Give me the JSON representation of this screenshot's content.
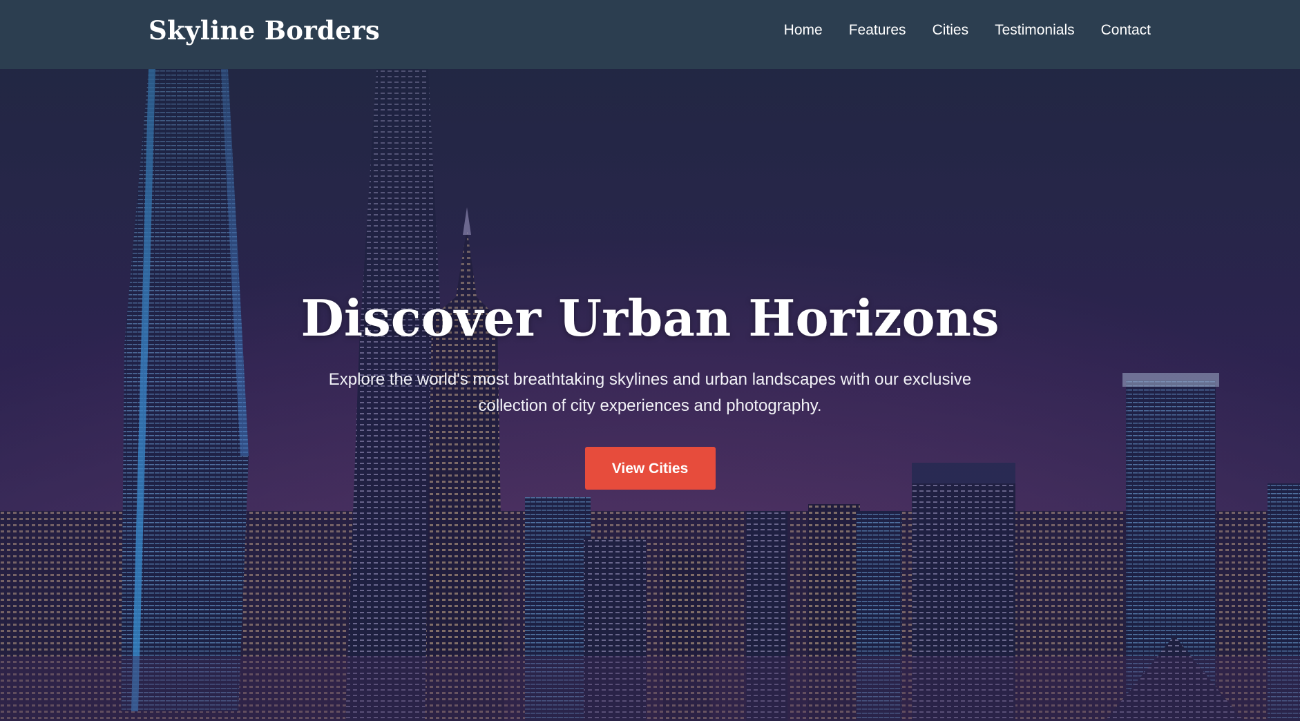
{
  "header": {
    "logo": "Skyline Borders",
    "nav": [
      {
        "label": "Home"
      },
      {
        "label": "Features"
      },
      {
        "label": "Cities"
      },
      {
        "label": "Testimonials"
      },
      {
        "label": "Contact"
      }
    ]
  },
  "hero": {
    "title": "Discover Urban Horizons",
    "subtitle": "Explore the world's most breathtaking skylines and urban landscapes with our exclusive collection of city experiences and photography.",
    "cta_label": "View Cities",
    "background_image": "night-city-skyline-photo"
  },
  "colors": {
    "nav_bg": "#2c3e50",
    "accent": "#e74c3c",
    "text": "#ffffff"
  }
}
